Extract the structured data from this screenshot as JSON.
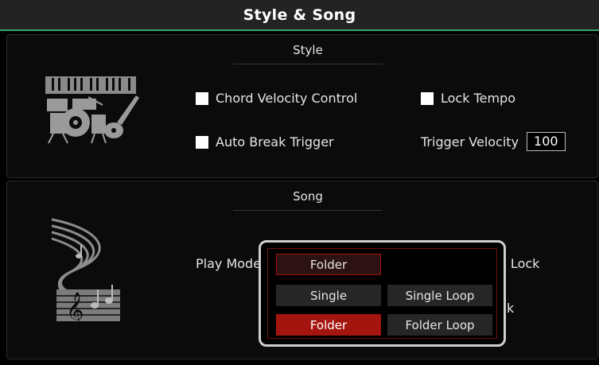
{
  "header": {
    "title": "Style & Song"
  },
  "style_section": {
    "title": "Style",
    "icon": "keyboard-drums-guitar-icon",
    "chord_velocity_control": "Chord Velocity Control",
    "lock_tempo": "Lock Tempo",
    "auto_break_trigger": "Auto Break Trigger",
    "trigger_velocity_label": "Trigger Velocity",
    "trigger_velocity_value": "100"
  },
  "song_section": {
    "title": "Song",
    "icon": "music-staff-swirl-icon",
    "play_mode_label": "Play Mode",
    "lock_label_partial": "e Lock",
    "partial_text_k": "k"
  },
  "play_mode_popup": {
    "current_value": "Folder",
    "options": [
      "Single",
      "Single Loop",
      "Folder",
      "Folder Loop"
    ],
    "selected": "Folder"
  },
  "colors": {
    "accent_red": "#a5150f",
    "divider_green": "#3aa36a",
    "background": "#000000"
  }
}
